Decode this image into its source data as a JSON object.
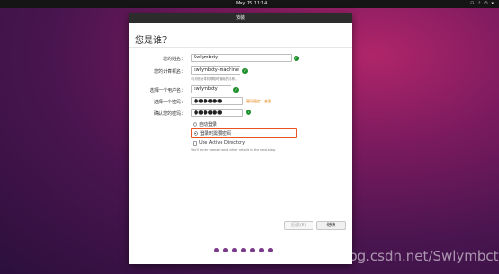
{
  "topbar": {
    "clock": "May 15  11:14"
  },
  "window": {
    "title": "安装",
    "heading": "您是谁？",
    "fields": {
      "name": {
        "label": "您的姓名：",
        "value": "Swlymbcty"
      },
      "computer": {
        "label": "您的计算机名：",
        "value": "swlymbcty-machine",
        "hint": "与其他计算机联络时使用的名称。"
      },
      "username": {
        "label": "选择一个用户名：",
        "value": "swlymbcty"
      },
      "password": {
        "label": "选择一个密码：",
        "value": "●●●●●●",
        "strength": "密码强度：合理"
      },
      "confirm": {
        "label": "确认您的密码：",
        "value": "●●●●●●"
      }
    },
    "options": {
      "auto_login": "自动登录",
      "require_password": "登录时需要密码",
      "active_directory": "Use Active Directory",
      "ad_hint": "You'll enter domain and other details in the next step."
    },
    "buttons": {
      "back": "后退(B)",
      "next": "继续"
    }
  },
  "watermark": "https://blog.csdn.net/Swlymbcty",
  "colors": {
    "accent": "#e95420",
    "ok": "#1d8f2a",
    "dot": "#7a3a8a"
  }
}
